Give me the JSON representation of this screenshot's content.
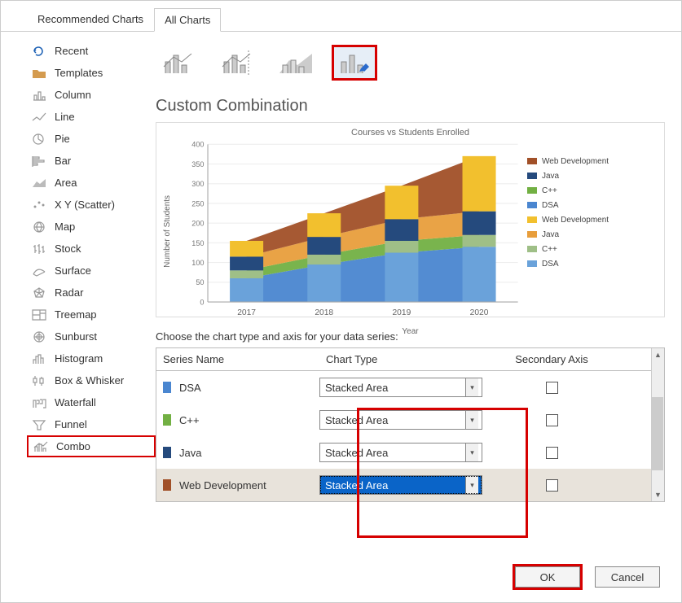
{
  "tabs": {
    "recommended": "Recommended Charts",
    "all": "All Charts"
  },
  "sidebar": {
    "items": [
      "Recent",
      "Templates",
      "Column",
      "Line",
      "Pie",
      "Bar",
      "Area",
      "X Y (Scatter)",
      "Map",
      "Stock",
      "Surface",
      "Radar",
      "Treemap",
      "Sunburst",
      "Histogram",
      "Box & Whisker",
      "Waterfall",
      "Funnel",
      "Combo"
    ]
  },
  "heading": "Custom Combination",
  "chart_data": {
    "type": "stacked-area-and-bar",
    "title": "Courses vs Students Enrolled",
    "xlabel": "Year",
    "ylabel": "Number of Students",
    "categories": [
      "2017",
      "2018",
      "2019",
      "2020"
    ],
    "ylim": [
      0,
      400
    ],
    "yticks": [
      0,
      50,
      100,
      150,
      200,
      250,
      300,
      350,
      400
    ],
    "series": [
      {
        "name": "DSA",
        "color": "#4a86d0",
        "values": [
          60,
          95,
          125,
          140
        ]
      },
      {
        "name": "C++",
        "color": "#72b043",
        "values": [
          20,
          25,
          30,
          30
        ]
      },
      {
        "name": "Java",
        "color": "#e89e3c",
        "values": [
          35,
          45,
          55,
          60
        ]
      },
      {
        "name": "Web Development",
        "color": "#a15028",
        "values": [
          40,
          60,
          85,
          140
        ]
      }
    ],
    "bar_series": [
      {
        "name": "DSA",
        "color": "#6aa2da",
        "values": [
          60,
          95,
          125,
          140
        ]
      },
      {
        "name": "C++",
        "color": "#9fbf87",
        "values": [
          20,
          25,
          30,
          30
        ]
      },
      {
        "name": "Java",
        "color": "#254a7d",
        "values": [
          35,
          45,
          55,
          60
        ]
      },
      {
        "name": "Web Development",
        "color": "#f2c02e",
        "values": [
          40,
          60,
          85,
          140
        ]
      }
    ],
    "legend": [
      {
        "name": "Web Development",
        "color": "#a15028"
      },
      {
        "name": "Java",
        "color": "#254a7d"
      },
      {
        "name": "C++",
        "color": "#72b043"
      },
      {
        "name": "DSA",
        "color": "#4a86d0"
      },
      {
        "name": "Web Development",
        "color": "#f2c02e"
      },
      {
        "name": "Java",
        "color": "#e89e3c"
      },
      {
        "name": "C++",
        "color": "#9fbf87"
      },
      {
        "name": "DSA",
        "color": "#6aa2da"
      }
    ]
  },
  "instr": "Choose the chart type and axis for your data series:",
  "gridhead": {
    "series": "Series Name",
    "type": "Chart Type",
    "secondary": "Secondary Axis"
  },
  "rows": [
    {
      "name": "DSA",
      "color": "#4a86d0",
      "type": "Stacked Area",
      "secondary": false
    },
    {
      "name": "C++",
      "color": "#72b043",
      "type": "Stacked Area",
      "secondary": false
    },
    {
      "name": "Java",
      "color": "#254a7d",
      "type": "Stacked Area",
      "secondary": false
    },
    {
      "name": "Web Development",
      "color": "#a15028",
      "type": "Stacked Area",
      "secondary": false,
      "selected": true
    }
  ],
  "footer": {
    "ok": "OK",
    "cancel": "Cancel"
  }
}
